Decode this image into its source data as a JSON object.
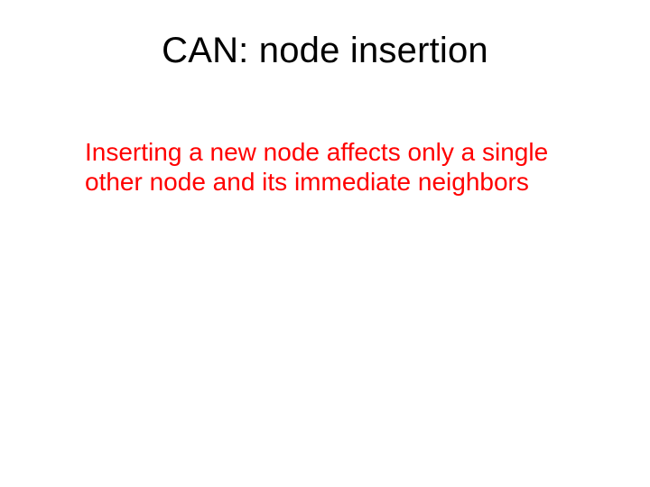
{
  "slide": {
    "title": "CAN: node insertion",
    "body": "Inserting a new node affects only a single other node and its immediate neighbors"
  },
  "colors": {
    "title": "#000000",
    "body": "#ff0000",
    "background": "#ffffff"
  }
}
